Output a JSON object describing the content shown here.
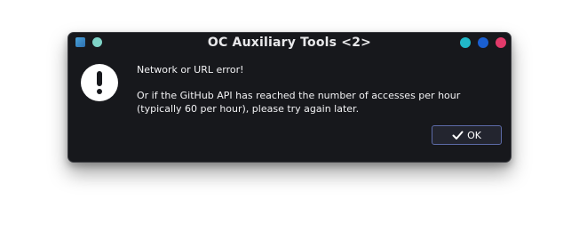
{
  "window": {
    "title": "OC Auxiliary Tools <2>",
    "controls": {
      "minimize_color": "#21b8c8",
      "maximize_color": "#1a5fd0",
      "close_color": "#e23a6a"
    }
  },
  "dialog": {
    "icon": "exclamation-icon",
    "message_line1": "Network or URL error!",
    "message_line2": "Or if the GitHub API has reached the number of accesses per hour (typically 60 per hour), please try again later.",
    "ok_label": "OK",
    "ok_icon": "check-icon"
  }
}
